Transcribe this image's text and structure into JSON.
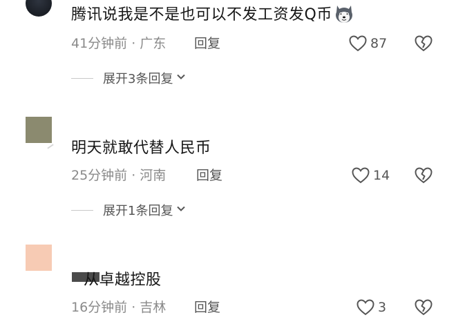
{
  "comments": [
    {
      "text": "腾讯说我是不是也可以不发工资发Q币",
      "emoji": "husky-emoji-icon",
      "time": "41分钟前",
      "separator": "·",
      "location": "广东",
      "reply_label": "回复",
      "likes": "87",
      "expand_label": "展开3条回复"
    },
    {
      "text": "明天就敢代替人民币",
      "time": "25分钟前",
      "separator": "·",
      "location": "河南",
      "reply_label": "回复",
      "likes": "14",
      "expand_label": "展开1条回复"
    },
    {
      "text": "从卓越控股",
      "time": "16分钟前",
      "separator": "·",
      "location": "吉林",
      "reply_label": "回复",
      "likes": "3"
    }
  ],
  "icons": {
    "like": "heart-outline-icon",
    "dislike": "broken-heart-icon",
    "expand": "chevron-down-icon"
  },
  "colors": {
    "text": "#161616",
    "meta": "#8a8a8a",
    "action": "#555555",
    "background": "#ffffff"
  }
}
